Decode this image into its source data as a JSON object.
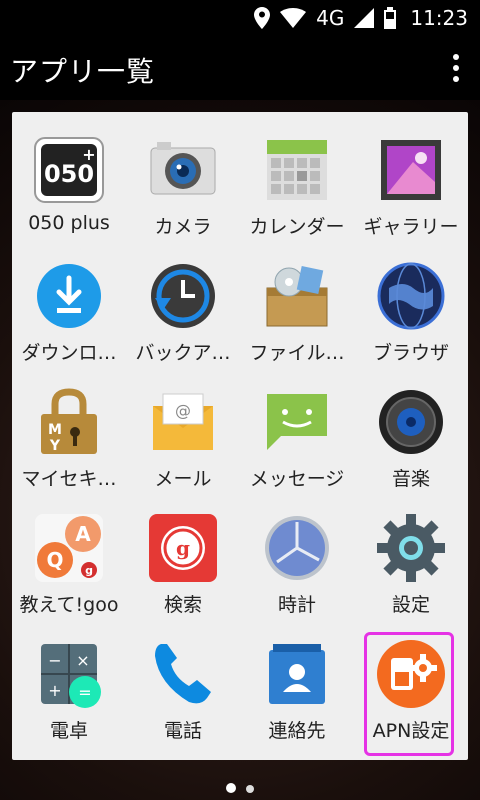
{
  "status_bar": {
    "network": "4G",
    "time": "11:23"
  },
  "app_bar": {
    "title": "アプリ一覧"
  },
  "apps": [
    {
      "label": "050 plus",
      "icon": "050plus-icon"
    },
    {
      "label": "カメラ",
      "icon": "camera-icon"
    },
    {
      "label": "カレンダー",
      "icon": "calendar-icon"
    },
    {
      "label": "ギャラリー",
      "icon": "gallery-icon"
    },
    {
      "label": "ダウンロ…",
      "icon": "download-icon"
    },
    {
      "label": "バックア…",
      "icon": "backup-icon"
    },
    {
      "label": "ファイル…",
      "icon": "file-manager-icon"
    },
    {
      "label": "ブラウザ",
      "icon": "browser-icon"
    },
    {
      "label": "マイセキ…",
      "icon": "lock-icon"
    },
    {
      "label": "メール",
      "icon": "email-icon"
    },
    {
      "label": "メッセージ",
      "icon": "message-icon"
    },
    {
      "label": "音楽",
      "icon": "music-icon"
    },
    {
      "label": "教えて!goo",
      "icon": "oshiete-goo-icon"
    },
    {
      "label": "検索",
      "icon": "search-goo-icon"
    },
    {
      "label": "時計",
      "icon": "clock-icon"
    },
    {
      "label": "設定",
      "icon": "settings-icon"
    },
    {
      "label": "電卓",
      "icon": "calculator-icon"
    },
    {
      "label": "電話",
      "icon": "phone-icon"
    },
    {
      "label": "連絡先",
      "icon": "contacts-icon"
    },
    {
      "label": "APN設定",
      "icon": "apn-settings-icon"
    }
  ],
  "page_indicator": {
    "pages": 2,
    "current": 1
  }
}
